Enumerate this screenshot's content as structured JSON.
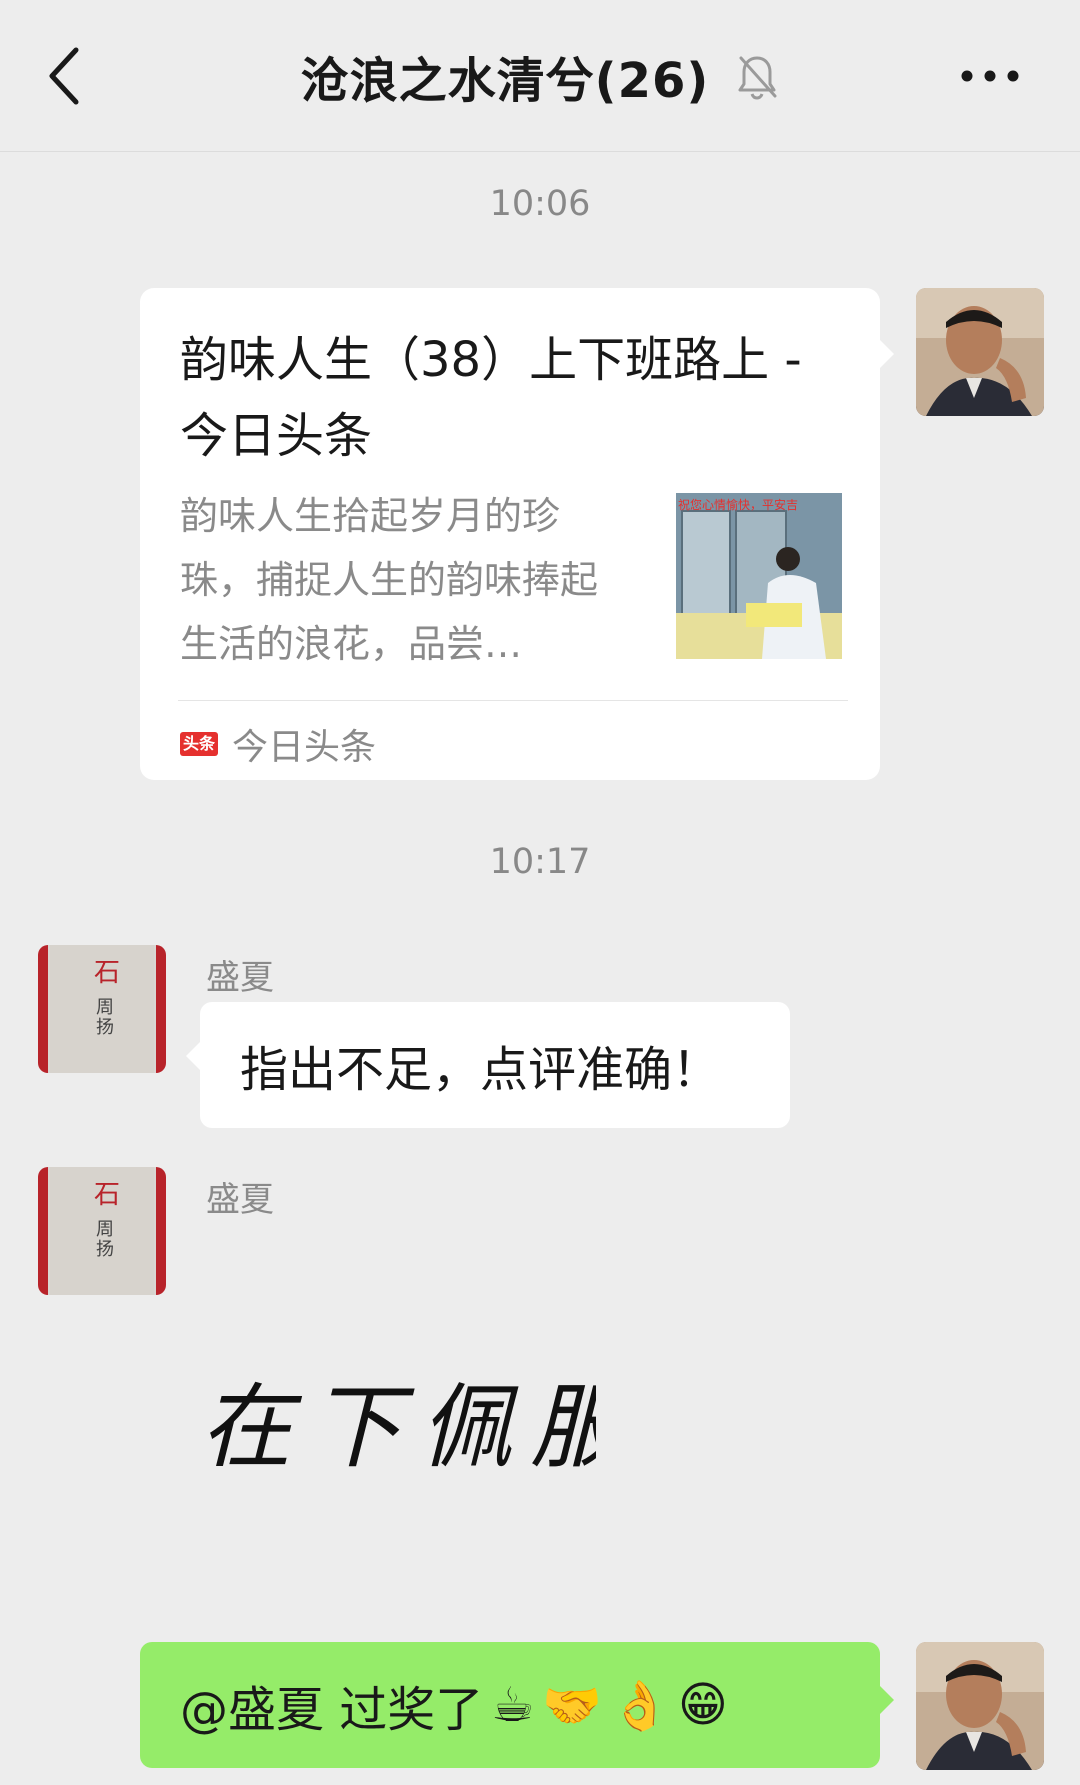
{
  "header": {
    "title": "沧浪之水清兮(26)",
    "back_icon": "chevron-left-icon",
    "mute_icon": "bell-off-icon",
    "more_icon": "more-dots-icon"
  },
  "messages": {
    "time1": "10:06",
    "card": {
      "title": "韵味人生（38）上下班路上 - 今日头条",
      "description": "韵味人生拾起岁月的珍珠，捕捉人生的韵味捧起生活的浪花，品尝…",
      "source_logo": "头条",
      "source_name": "今日头条"
    },
    "time2": "10:17",
    "msg1": {
      "sender": "盛夏",
      "text": "指出不足，点评准确！"
    },
    "msg2": {
      "sender": "盛夏",
      "sticker_text": "在下佩服"
    },
    "reply": {
      "text": "@盛夏  过奖了",
      "emojis": [
        "☕",
        "🤝",
        "👌",
        "😁"
      ]
    }
  },
  "colors": {
    "background": "#ededed",
    "bubble_green": "#95ec69",
    "bubble_white": "#ffffff",
    "toutiao_red": "#e5302e"
  }
}
